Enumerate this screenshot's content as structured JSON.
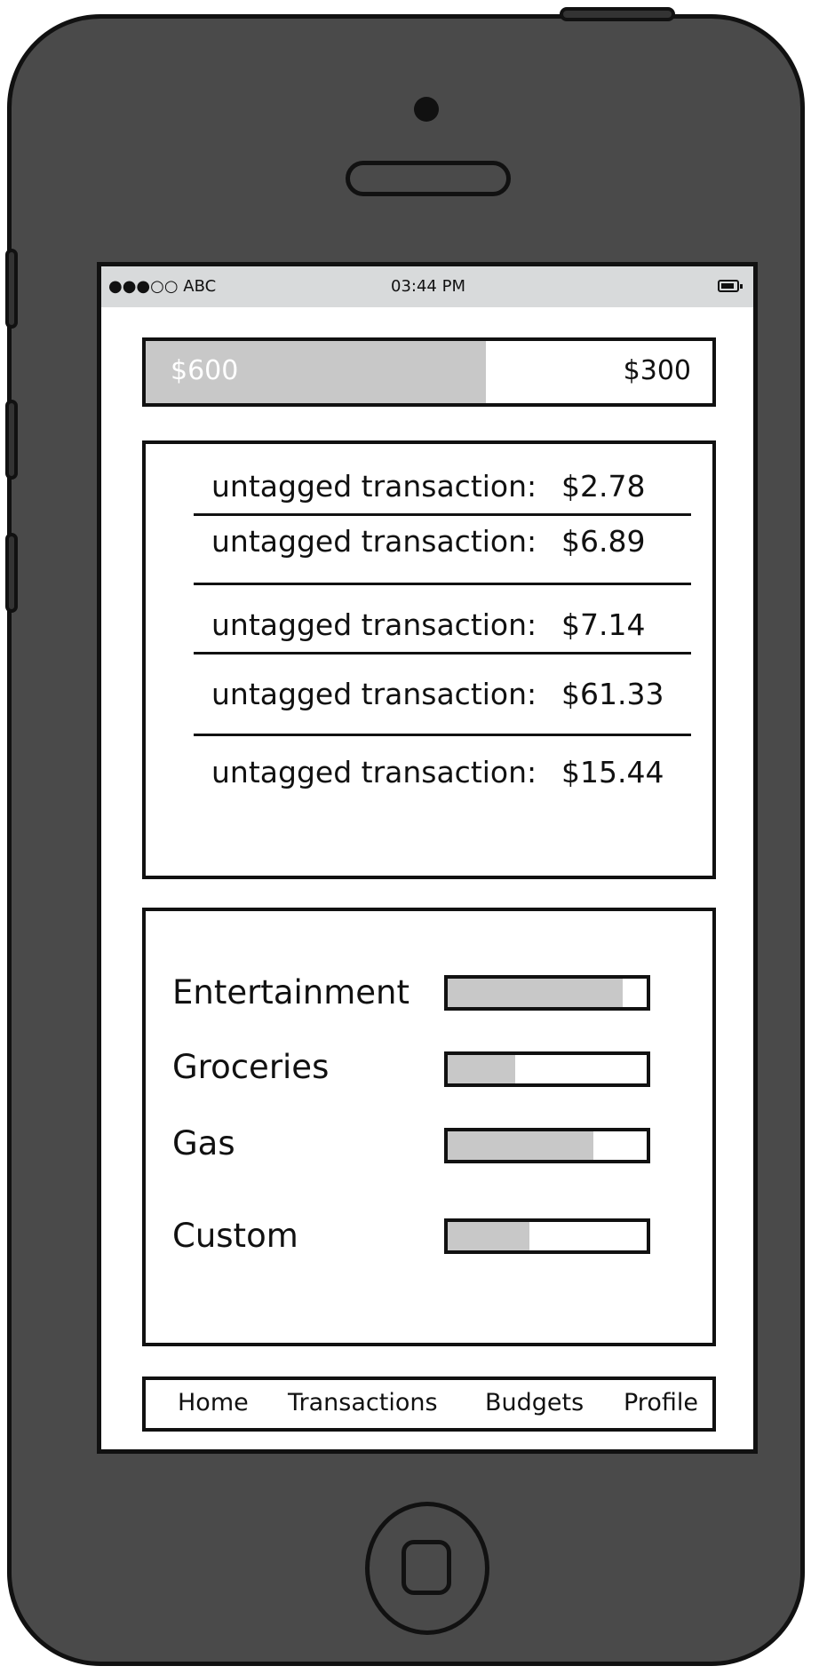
{
  "status_bar": {
    "carrier": "●●●○○ ABC",
    "time": "03:44 PM",
    "battery_icon": "battery-icon"
  },
  "balance": {
    "spent": "$600",
    "remaining": "$300",
    "fill_fraction": 0.6
  },
  "transactions": [
    {
      "label": "untagged transaction:",
      "amount": "$2.78"
    },
    {
      "label": "untagged transaction:",
      "amount": "$6.89"
    },
    {
      "label": "untagged transaction:",
      "amount": "$7.14"
    },
    {
      "label": "untagged transaction:",
      "amount": "$61.33"
    },
    {
      "label": "untagged transaction:",
      "amount": "$15.44"
    }
  ],
  "budgets": [
    {
      "label": "Entertainment",
      "fill_fraction": 0.88
    },
    {
      "label": "Groceries",
      "fill_fraction": 0.34
    },
    {
      "label": "Gas",
      "fill_fraction": 0.73
    },
    {
      "label": "Custom",
      "fill_fraction": 0.41
    }
  ],
  "nav": {
    "home": "Home",
    "transactions": "Transactions",
    "budgets": "Budgets",
    "profile": "Profile"
  },
  "colors": {
    "phone_body": "#4a4a4a",
    "status_bar": "#d8dadb",
    "bar_fill": "#c8c8c8"
  }
}
